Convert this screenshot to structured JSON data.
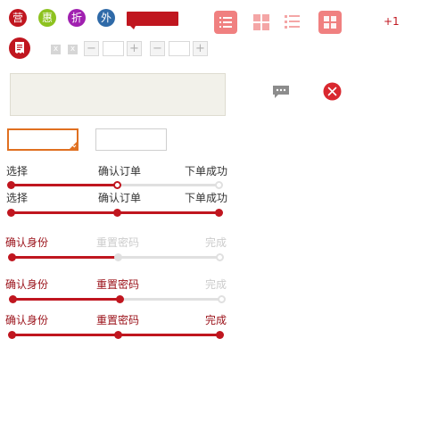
{
  "badges": [
    {
      "label": "营",
      "color": "#c0161f"
    },
    {
      "label": "惠",
      "color": "#8dc21f"
    },
    {
      "label": "折",
      "color": "#a020b0"
    },
    {
      "label": "外",
      "color": "#2f6aa8"
    }
  ],
  "plus_one": "+1",
  "x_marks": [
    "x",
    "x"
  ],
  "steppers": [
    {
      "minus": "−",
      "plus": "+",
      "value": ""
    },
    {
      "minus": "−",
      "plus": "+",
      "value": ""
    }
  ],
  "steps": {
    "row1": {
      "labels": [
        "选择",
        "确认订单",
        "下单成功"
      ],
      "progress": 0.5
    },
    "row2": {
      "labels": [
        "选择",
        "确认订单",
        "下单成功"
      ],
      "progress": 1.0
    },
    "row3": {
      "labels": [
        "确认身份",
        "重置密码",
        "完成"
      ],
      "progress": 0.5
    },
    "row4": {
      "labels": [
        "确认身份",
        "重置密码",
        "完成"
      ],
      "progress": 0.5
    },
    "row5": {
      "labels": [
        "确认身份",
        "重置密码",
        "完成"
      ],
      "progress": 1.0
    }
  },
  "colors": {
    "accent": "#c0161f",
    "orange": "#e07020",
    "light_pink": "#f08080",
    "gray": "#e0e0e0"
  }
}
